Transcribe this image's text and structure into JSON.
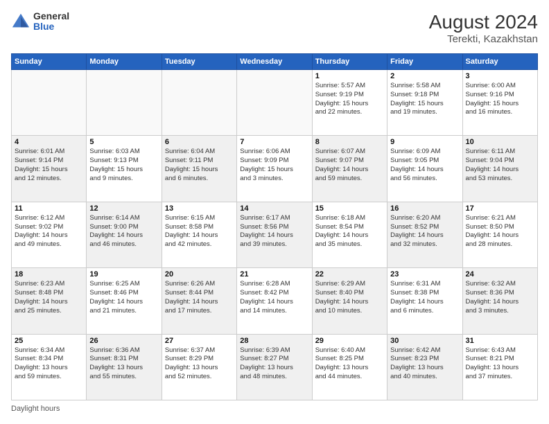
{
  "header": {
    "logo_line1": "General",
    "logo_line2": "Blue",
    "title": "August 2024",
    "subtitle": "Terekti, Kazakhstan"
  },
  "days_of_week": [
    "Sunday",
    "Monday",
    "Tuesday",
    "Wednesday",
    "Thursday",
    "Friday",
    "Saturday"
  ],
  "footer": "Daylight hours",
  "weeks": [
    [
      {
        "day": "",
        "info": "",
        "empty": true
      },
      {
        "day": "",
        "info": "",
        "empty": true
      },
      {
        "day": "",
        "info": "",
        "empty": true
      },
      {
        "day": "",
        "info": "",
        "empty": true
      },
      {
        "day": "1",
        "info": "Sunrise: 5:57 AM\nSunset: 9:19 PM\nDaylight: 15 hours\nand 22 minutes."
      },
      {
        "day": "2",
        "info": "Sunrise: 5:58 AM\nSunset: 9:18 PM\nDaylight: 15 hours\nand 19 minutes."
      },
      {
        "day": "3",
        "info": "Sunrise: 6:00 AM\nSunset: 9:16 PM\nDaylight: 15 hours\nand 16 minutes."
      }
    ],
    [
      {
        "day": "4",
        "info": "Sunrise: 6:01 AM\nSunset: 9:14 PM\nDaylight: 15 hours\nand 12 minutes.",
        "gray": true
      },
      {
        "day": "5",
        "info": "Sunrise: 6:03 AM\nSunset: 9:13 PM\nDaylight: 15 hours\nand 9 minutes."
      },
      {
        "day": "6",
        "info": "Sunrise: 6:04 AM\nSunset: 9:11 PM\nDaylight: 15 hours\nand 6 minutes.",
        "gray": true
      },
      {
        "day": "7",
        "info": "Sunrise: 6:06 AM\nSunset: 9:09 PM\nDaylight: 15 hours\nand 3 minutes."
      },
      {
        "day": "8",
        "info": "Sunrise: 6:07 AM\nSunset: 9:07 PM\nDaylight: 14 hours\nand 59 minutes.",
        "gray": true
      },
      {
        "day": "9",
        "info": "Sunrise: 6:09 AM\nSunset: 9:05 PM\nDaylight: 14 hours\nand 56 minutes."
      },
      {
        "day": "10",
        "info": "Sunrise: 6:11 AM\nSunset: 9:04 PM\nDaylight: 14 hours\nand 53 minutes.",
        "gray": true
      }
    ],
    [
      {
        "day": "11",
        "info": "Sunrise: 6:12 AM\nSunset: 9:02 PM\nDaylight: 14 hours\nand 49 minutes."
      },
      {
        "day": "12",
        "info": "Sunrise: 6:14 AM\nSunset: 9:00 PM\nDaylight: 14 hours\nand 46 minutes.",
        "gray": true
      },
      {
        "day": "13",
        "info": "Sunrise: 6:15 AM\nSunset: 8:58 PM\nDaylight: 14 hours\nand 42 minutes."
      },
      {
        "day": "14",
        "info": "Sunrise: 6:17 AM\nSunset: 8:56 PM\nDaylight: 14 hours\nand 39 minutes.",
        "gray": true
      },
      {
        "day": "15",
        "info": "Sunrise: 6:18 AM\nSunset: 8:54 PM\nDaylight: 14 hours\nand 35 minutes."
      },
      {
        "day": "16",
        "info": "Sunrise: 6:20 AM\nSunset: 8:52 PM\nDaylight: 14 hours\nand 32 minutes.",
        "gray": true
      },
      {
        "day": "17",
        "info": "Sunrise: 6:21 AM\nSunset: 8:50 PM\nDaylight: 14 hours\nand 28 minutes."
      }
    ],
    [
      {
        "day": "18",
        "info": "Sunrise: 6:23 AM\nSunset: 8:48 PM\nDaylight: 14 hours\nand 25 minutes.",
        "gray": true
      },
      {
        "day": "19",
        "info": "Sunrise: 6:25 AM\nSunset: 8:46 PM\nDaylight: 14 hours\nand 21 minutes."
      },
      {
        "day": "20",
        "info": "Sunrise: 6:26 AM\nSunset: 8:44 PM\nDaylight: 14 hours\nand 17 minutes.",
        "gray": true
      },
      {
        "day": "21",
        "info": "Sunrise: 6:28 AM\nSunset: 8:42 PM\nDaylight: 14 hours\nand 14 minutes."
      },
      {
        "day": "22",
        "info": "Sunrise: 6:29 AM\nSunset: 8:40 PM\nDaylight: 14 hours\nand 10 minutes.",
        "gray": true
      },
      {
        "day": "23",
        "info": "Sunrise: 6:31 AM\nSunset: 8:38 PM\nDaylight: 14 hours\nand 6 minutes."
      },
      {
        "day": "24",
        "info": "Sunrise: 6:32 AM\nSunset: 8:36 PM\nDaylight: 14 hours\nand 3 minutes.",
        "gray": true
      }
    ],
    [
      {
        "day": "25",
        "info": "Sunrise: 6:34 AM\nSunset: 8:34 PM\nDaylight: 13 hours\nand 59 minutes."
      },
      {
        "day": "26",
        "info": "Sunrise: 6:36 AM\nSunset: 8:31 PM\nDaylight: 13 hours\nand 55 minutes.",
        "gray": true
      },
      {
        "day": "27",
        "info": "Sunrise: 6:37 AM\nSunset: 8:29 PM\nDaylight: 13 hours\nand 52 minutes."
      },
      {
        "day": "28",
        "info": "Sunrise: 6:39 AM\nSunset: 8:27 PM\nDaylight: 13 hours\nand 48 minutes.",
        "gray": true
      },
      {
        "day": "29",
        "info": "Sunrise: 6:40 AM\nSunset: 8:25 PM\nDaylight: 13 hours\nand 44 minutes."
      },
      {
        "day": "30",
        "info": "Sunrise: 6:42 AM\nSunset: 8:23 PM\nDaylight: 13 hours\nand 40 minutes.",
        "gray": true
      },
      {
        "day": "31",
        "info": "Sunrise: 6:43 AM\nSunset: 8:21 PM\nDaylight: 13 hours\nand 37 minutes."
      }
    ]
  ]
}
